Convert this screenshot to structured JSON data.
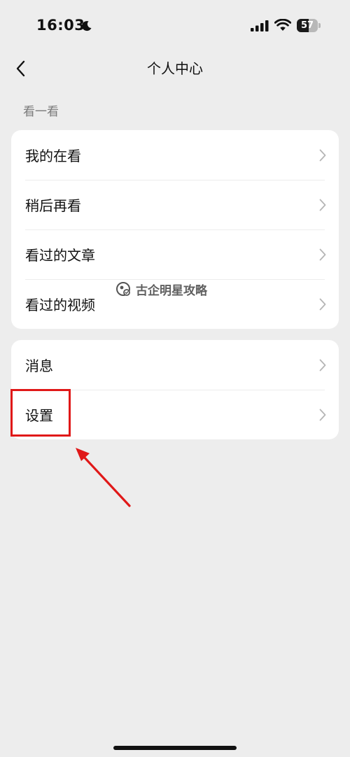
{
  "status_bar": {
    "time": "16:03",
    "battery_level": "57",
    "battery_fraction": 0.57,
    "icons": [
      "moon-icon",
      "cellular-signal-icon",
      "wifi-icon",
      "battery-icon"
    ]
  },
  "nav": {
    "title": "个人中心",
    "back_icon": "chevron-left-icon"
  },
  "section": {
    "label": "看一看"
  },
  "card_watch": {
    "items": [
      {
        "label": "我的在看"
      },
      {
        "label": "稍后再看"
      },
      {
        "label": "看过的文章"
      },
      {
        "label": "看过的视频"
      }
    ]
  },
  "card_settings": {
    "items": [
      {
        "label": "消息"
      },
      {
        "label": "设置"
      }
    ]
  },
  "watermark": {
    "text": "古企明星攻略"
  },
  "colors": {
    "background": "#ededed",
    "card": "#ffffff",
    "annotation_red": "#e01818"
  }
}
